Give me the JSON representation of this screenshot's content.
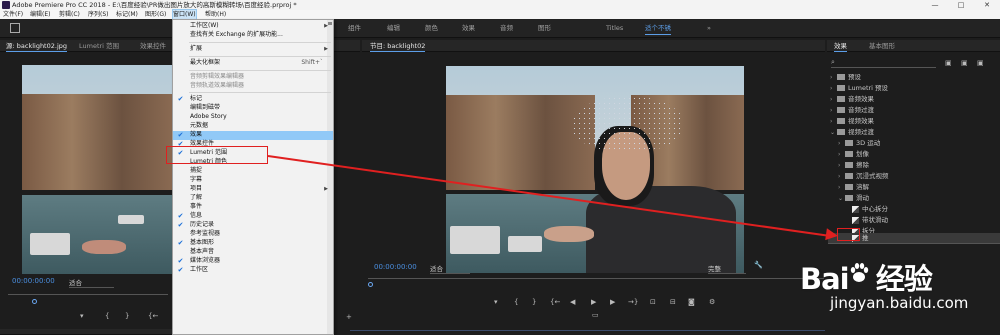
{
  "window": {
    "title": "Adobe Premiere Pro CC 2018 - E:\\百度经验\\PR做出图片放大的高斯模糊转场\\百度经验.prproj *",
    "minimize": "—",
    "maximize": "□",
    "close": "✕"
  },
  "menubar": {
    "items": [
      "文件(F)",
      "编辑(E)",
      "剪辑(C)",
      "序列(S)",
      "标记(M)",
      "图形(G)",
      "窗口(W)",
      "帮助(H)"
    ]
  },
  "workspaces": {
    "items": [
      "组件",
      "编辑",
      "颜色",
      "效果",
      "音频",
      "图形",
      "Titles",
      "适个不锈"
    ],
    "active_index": 7,
    "overflow": "»"
  },
  "source_panel": {
    "tabs": [
      "源: backlight02.jpg",
      "Lumetri 范围",
      "效果控件"
    ],
    "timecode": "00:00:00:00",
    "fit": "适合"
  },
  "program_panel": {
    "tab": "节目: backlight02",
    "timecode": "00:00:00:00",
    "fit": "适合",
    "quality": "完整"
  },
  "effects_panel": {
    "tabs": [
      "效果",
      "基本图形"
    ],
    "search_placeholder": "",
    "tree": [
      {
        "label": "预设",
        "level": 0,
        "kind": "folder",
        "expanded": false
      },
      {
        "label": "Lumetri 预设",
        "level": 0,
        "kind": "folder",
        "expanded": false
      },
      {
        "label": "音频效果",
        "level": 0,
        "kind": "folder",
        "expanded": false
      },
      {
        "label": "音频过渡",
        "level": 0,
        "kind": "folder",
        "expanded": false
      },
      {
        "label": "视频效果",
        "level": 0,
        "kind": "folder",
        "expanded": false
      },
      {
        "label": "视频过渡",
        "level": 0,
        "kind": "folder",
        "expanded": true
      },
      {
        "label": "3D 运动",
        "level": 1,
        "kind": "folder",
        "expanded": false
      },
      {
        "label": "划像",
        "level": 1,
        "kind": "folder",
        "expanded": false
      },
      {
        "label": "擦除",
        "level": 1,
        "kind": "folder",
        "expanded": false
      },
      {
        "label": "沉浸式视频",
        "level": 1,
        "kind": "folder",
        "expanded": false
      },
      {
        "label": "溶解",
        "level": 1,
        "kind": "folder",
        "expanded": false
      },
      {
        "label": "滑动",
        "level": 1,
        "kind": "folder",
        "expanded": true
      },
      {
        "label": "中心拆分",
        "level": 2,
        "kind": "effect"
      },
      {
        "label": "带状滑动",
        "level": 2,
        "kind": "effect"
      },
      {
        "label": "拆分",
        "level": 2,
        "kind": "effect"
      },
      {
        "label": "推",
        "level": 2,
        "kind": "effect"
      }
    ]
  },
  "window_menu": {
    "rows": [
      {
        "label": "工作区(W)",
        "arrow": "▶",
        "checked": false
      },
      {
        "label": "查找有关 Exchange 的扩展功能...",
        "checked": false
      },
      {
        "sep": true
      },
      {
        "label": "扩展",
        "arrow": "▶",
        "checked": false
      },
      {
        "sep": true
      },
      {
        "label": "最大化框架",
        "shortcut": "Shift+`",
        "checked": false
      },
      {
        "sep": true
      },
      {
        "label": "音频剪辑效果编辑器",
        "disabled": true,
        "checked": false
      },
      {
        "label": "音频轨道效果编辑器",
        "disabled": true,
        "checked": false
      },
      {
        "sep": true
      },
      {
        "label": "标记",
        "checked": true
      },
      {
        "label": "编辑到磁带",
        "checked": false
      },
      {
        "label": "Adobe Story",
        "checked": false
      },
      {
        "label": "元数据",
        "checked": false
      },
      {
        "label": "效果",
        "checked": true,
        "highlight": true
      },
      {
        "label": "效果控件",
        "checked": true
      },
      {
        "label": "Lumetri 范围",
        "checked": true
      },
      {
        "label": "Lumetri 颜色",
        "checked": false
      },
      {
        "label": "捕捉",
        "checked": false
      },
      {
        "label": "字幕",
        "checked": false
      },
      {
        "label": "项目",
        "arrow": "▶",
        "checked": false
      },
      {
        "label": "了解",
        "checked": false
      },
      {
        "label": "事件",
        "checked": false
      },
      {
        "label": "信息",
        "checked": true
      },
      {
        "label": "历史记录",
        "checked": true
      },
      {
        "label": "参考监视器",
        "checked": false
      },
      {
        "label": "基本图形",
        "checked": true
      },
      {
        "label": "基本声音",
        "checked": false
      },
      {
        "label": "媒体浏览器",
        "checked": true
      },
      {
        "label": "工作区",
        "checked": true
      }
    ]
  },
  "colors": {
    "accent_blue": "#4b8fe0",
    "menu_highlight": "#91c9f7",
    "annotation_red": "#e02020"
  },
  "watermark": {
    "brand": "Bai 经验",
    "url": "jingyan.baidu.com"
  }
}
